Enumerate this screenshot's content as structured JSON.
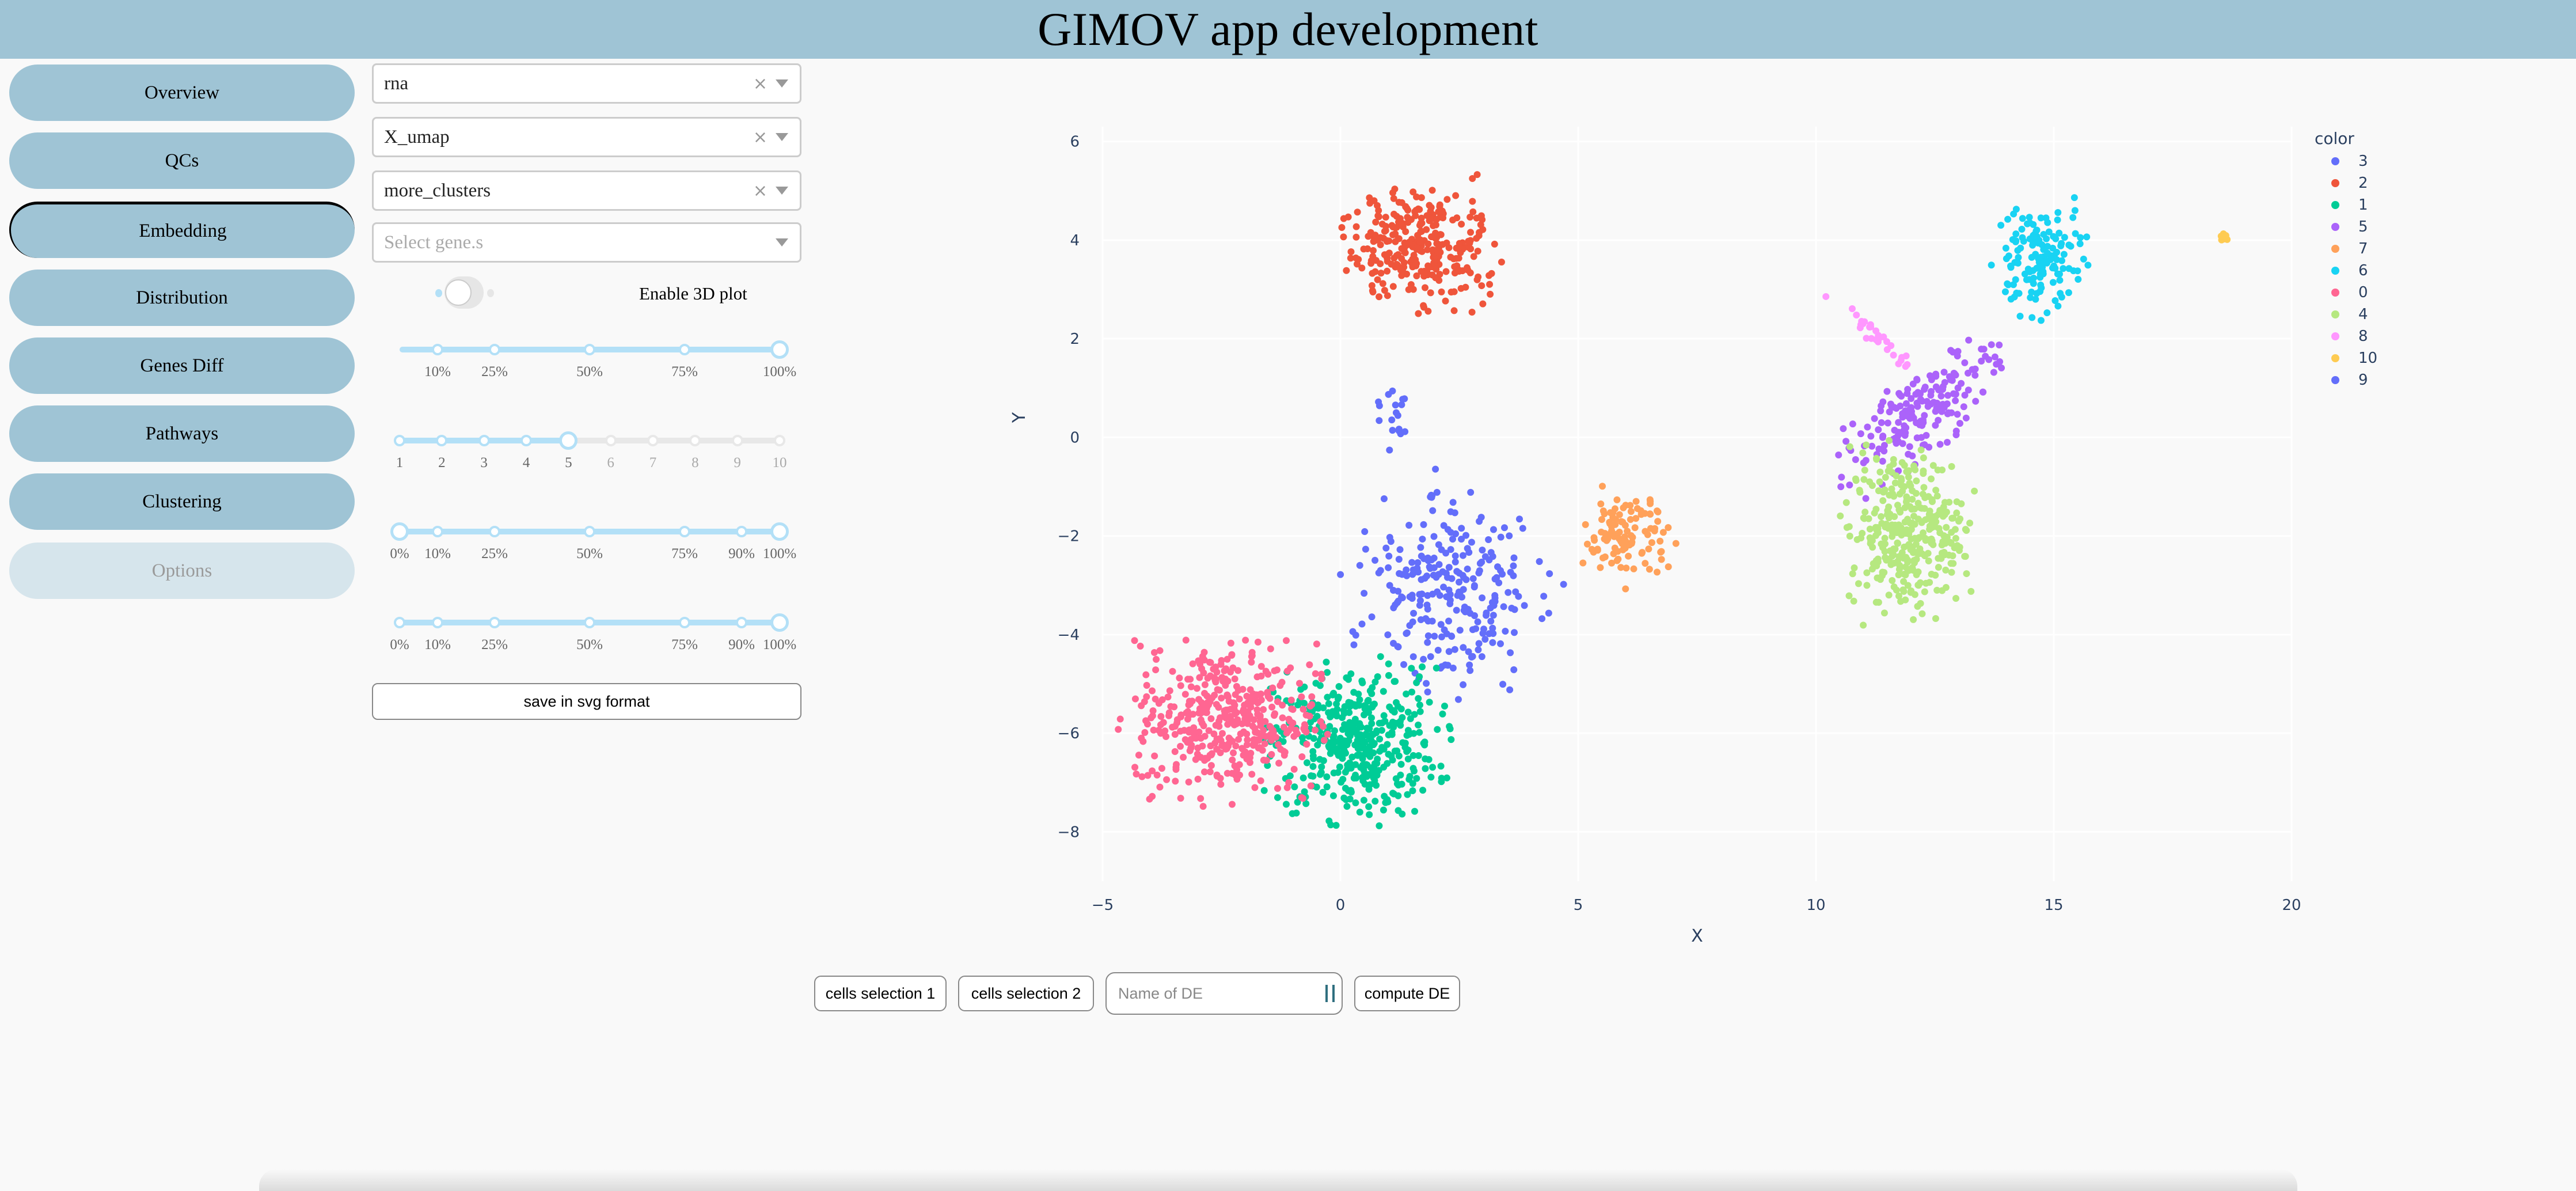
{
  "header": {
    "title": "GIMOV app development"
  },
  "sidebar": {
    "items": [
      {
        "label": "Overview",
        "state": "normal"
      },
      {
        "label": "QCs",
        "state": "normal"
      },
      {
        "label": "Embedding",
        "state": "active"
      },
      {
        "label": "Distribution",
        "state": "normal"
      },
      {
        "label": "Genes Diff",
        "state": "normal"
      },
      {
        "label": "Pathways",
        "state": "normal"
      },
      {
        "label": "Clustering",
        "state": "normal"
      },
      {
        "label": "Options",
        "state": "disabled"
      }
    ]
  },
  "controls": {
    "dropdowns": [
      {
        "value": "rna",
        "clearable": true
      },
      {
        "value": "X_umap",
        "clearable": true
      },
      {
        "value": "more_clusters",
        "clearable": true
      },
      {
        "value": "",
        "placeholder": "Select gene.s",
        "clearable": false
      }
    ],
    "toggle": {
      "label": "Enable 3D plot",
      "on": false
    },
    "sliders": [
      {
        "min": 0,
        "max": 100,
        "marks": [
          {
            "v": 10,
            "l": "10%"
          },
          {
            "v": 25,
            "l": "25%"
          },
          {
            "v": 50,
            "l": "50%"
          },
          {
            "v": 75,
            "l": "75%"
          },
          {
            "v": 100,
            "l": "100%"
          }
        ],
        "range": false,
        "value": 100,
        "start_value": 0
      },
      {
        "min": 1,
        "max": 10,
        "marks": [
          {
            "v": 1,
            "l": "1"
          },
          {
            "v": 2,
            "l": "2"
          },
          {
            "v": 3,
            "l": "3"
          },
          {
            "v": 4,
            "l": "4"
          },
          {
            "v": 5,
            "l": "5"
          },
          {
            "v": 6,
            "l": "6"
          },
          {
            "v": 7,
            "l": "7"
          },
          {
            "v": 8,
            "l": "8"
          },
          {
            "v": 9,
            "l": "9"
          },
          {
            "v": 10,
            "l": "10"
          }
        ],
        "range": false,
        "value": 5,
        "start_value": 1
      },
      {
        "min": 0,
        "max": 100,
        "marks": [
          {
            "v": 0,
            "l": "0%"
          },
          {
            "v": 10,
            "l": "10%"
          },
          {
            "v": 25,
            "l": "25%"
          },
          {
            "v": 50,
            "l": "50%"
          },
          {
            "v": 75,
            "l": "75%"
          },
          {
            "v": 90,
            "l": "90%"
          },
          {
            "v": 100,
            "l": "100%"
          }
        ],
        "range": true,
        "low": 0,
        "value": 100
      },
      {
        "min": 0,
        "max": 100,
        "marks": [
          {
            "v": 0,
            "l": "0%"
          },
          {
            "v": 10,
            "l": "10%"
          },
          {
            "v": 25,
            "l": "25%"
          },
          {
            "v": 50,
            "l": "50%"
          },
          {
            "v": 75,
            "l": "75%"
          },
          {
            "v": 90,
            "l": "90%"
          },
          {
            "v": 100,
            "l": "100%"
          }
        ],
        "range": false,
        "value": 100,
        "start_value": 0
      }
    ],
    "save_label": "save in svg format"
  },
  "de_panel": {
    "selection1_label": "cells selection 1",
    "selection2_label": "cells selection 2",
    "name_placeholder": "Name of DE",
    "name_value": "",
    "compute_label": "compute DE"
  },
  "chart_data": {
    "type": "scatter",
    "title": "",
    "xlabel": "X",
    "ylabel": "Y",
    "xlim": [
      -5,
      20
    ],
    "ylim": [
      -9,
      6.3
    ],
    "xticks": [
      -5,
      0,
      5,
      10,
      15,
      20
    ],
    "yticks": [
      -8,
      -6,
      -4,
      -2,
      0,
      2,
      4,
      6
    ],
    "grid": true,
    "legend": {
      "title": "color",
      "position": "top-right"
    },
    "series": [
      {
        "name": "3",
        "color": "#636efa",
        "n": 260,
        "shape": "elongated",
        "center": [
          2.3,
          -3.1
        ],
        "spread": [
          0.9,
          0.95
        ],
        "angle": 55
      },
      {
        "name": "2",
        "color": "#ef553b",
        "n": 300,
        "shape": "blob",
        "center": [
          1.7,
          3.9
        ],
        "spread": [
          0.6,
          0.7
        ],
        "angle": 90
      },
      {
        "name": "1",
        "color": "#00cc96",
        "n": 420,
        "shape": "blob",
        "center": [
          0.3,
          -6.2
        ],
        "spread": [
          0.85,
          0.75
        ],
        "angle": 0
      },
      {
        "name": "5",
        "color": "#ab63fa",
        "n": 190,
        "shape": "elongated",
        "center": [
          12.3,
          0.6
        ],
        "spread": [
          1.0,
          0.35
        ],
        "angle": 40
      },
      {
        "name": "7",
        "color": "#ffa15a",
        "n": 110,
        "shape": "blob",
        "center": [
          6.0,
          -2.0
        ],
        "spread": [
          0.45,
          0.45
        ],
        "angle": 0
      },
      {
        "name": "6",
        "color": "#19d3f3",
        "n": 140,
        "shape": "blob",
        "center": [
          14.7,
          3.6
        ],
        "spread": [
          0.45,
          0.55
        ],
        "angle": 0
      },
      {
        "name": "0",
        "color": "#ff6692",
        "n": 430,
        "shape": "blob",
        "center": [
          -2.4,
          -5.7
        ],
        "spread": [
          0.95,
          0.75
        ],
        "angle": 0
      },
      {
        "name": "4",
        "color": "#b6e880",
        "n": 340,
        "shape": "blob",
        "center": [
          11.9,
          -1.9
        ],
        "spread": [
          0.6,
          0.8
        ],
        "angle": 0
      },
      {
        "name": "8",
        "color": "#ff97ff",
        "n": 30,
        "shape": "elongated",
        "center": [
          11.1,
          2.2
        ],
        "spread": [
          0.55,
          0.08
        ],
        "angle": -40
      },
      {
        "name": "10",
        "color": "#fecb52",
        "n": 8,
        "shape": "blob",
        "center": [
          18.6,
          4.05
        ],
        "spread": [
          0.08,
          0.05
        ],
        "angle": 0
      },
      {
        "name": "9",
        "color": "#636efa",
        "n": 18,
        "shape": "blob",
        "center": [
          1.1,
          0.55
        ],
        "spread": [
          0.2,
          0.35
        ],
        "angle": 0
      }
    ]
  }
}
